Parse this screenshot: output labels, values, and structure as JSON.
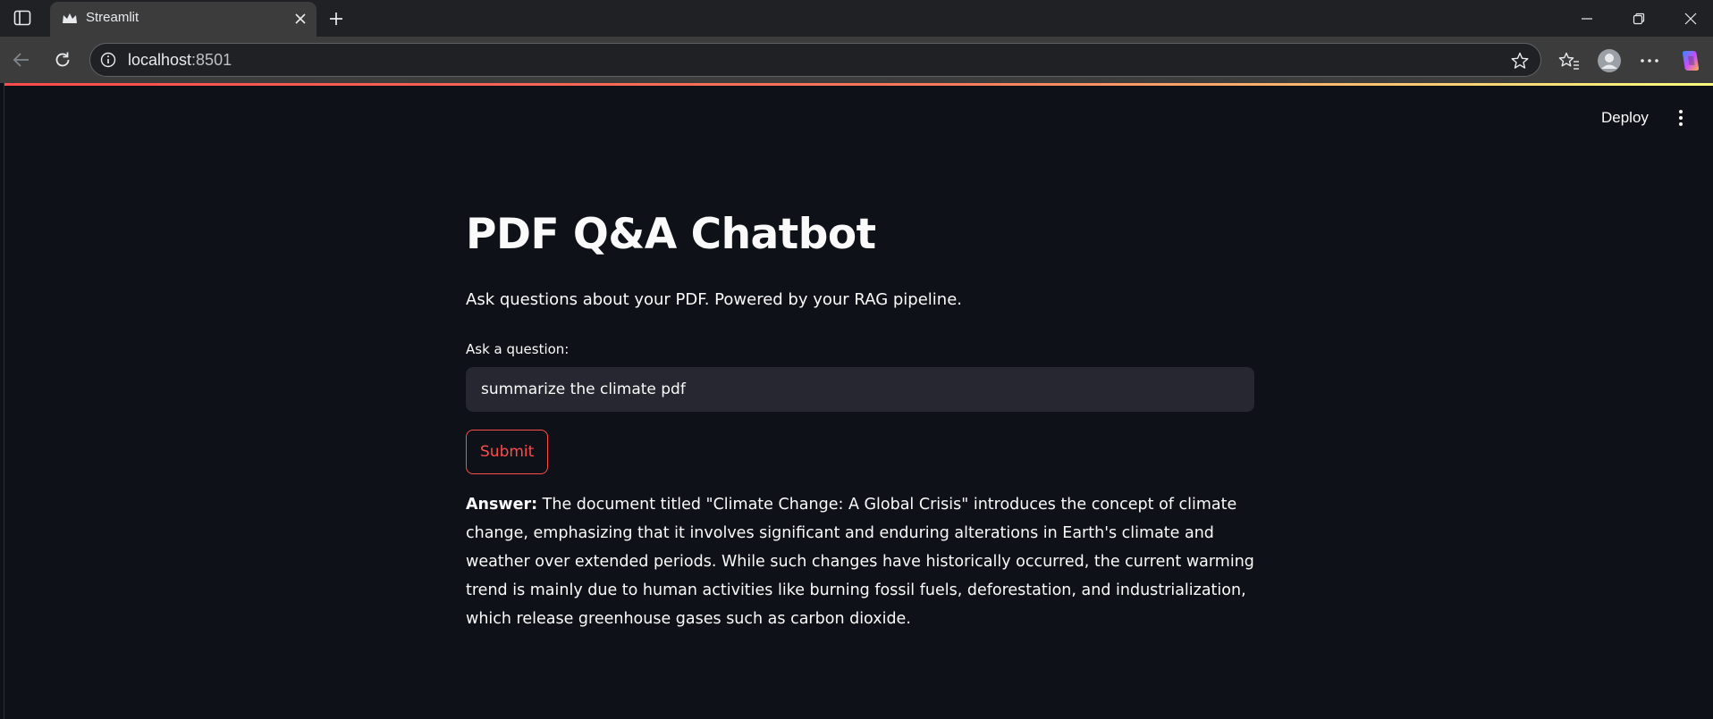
{
  "browser": {
    "tab_title": "Streamlit",
    "url_host": "localhost",
    "url_port": ":8501"
  },
  "header": {
    "deploy_label": "Deploy"
  },
  "main": {
    "title": "PDF Q&A Chatbot",
    "subtitle": "Ask questions about your PDF. Powered by your RAG pipeline.",
    "input_label": "Ask a question:",
    "input_value": "summarize the climate pdf",
    "submit_label": "Submit",
    "answer_label": "Answer:",
    "answer_text": "The document titled \"Climate Change: A Global Crisis\" introduces the concept of climate change, emphasizing that it involves significant and enduring alterations in Earth's climate and weather over extended periods. While such changes have historically occurred, the current warming trend is mainly due to human activities like burning fossil fuels, deforestation, and industrialization, which release greenhouse gases such as carbon dioxide."
  },
  "colors": {
    "background": "#0e1117",
    "text": "#fafafa",
    "accent": "#ff4b4b",
    "input_bg": "#262730"
  },
  "icons": {
    "sidebar_toggle": "sidebar-icon",
    "favicon": "streamlit-crown-icon",
    "tab_close": "close-icon",
    "new_tab": "plus-icon",
    "back": "back-arrow-icon",
    "reload": "reload-icon",
    "site_info": "info-icon",
    "favorite": "star-icon",
    "favorites": "favorites-icon",
    "profile": "profile-icon",
    "more": "more-horizontal-icon",
    "copilot": "copilot-icon",
    "main_menu": "more-vertical-icon"
  }
}
